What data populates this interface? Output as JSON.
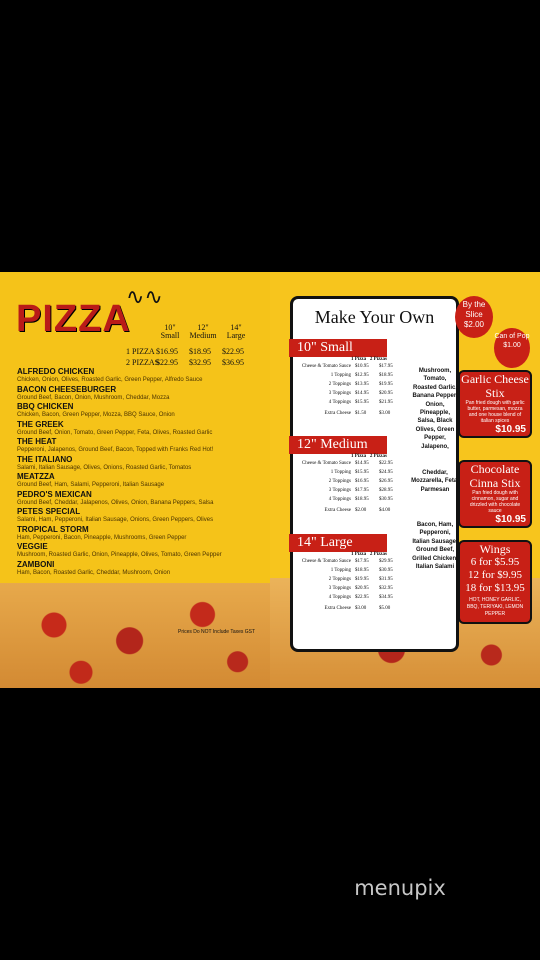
{
  "left": {
    "title": "PIZZA",
    "sizes": [
      {
        "label": "10\"",
        "sub": "Small"
      },
      {
        "label": "12\"",
        "sub": "Medium"
      },
      {
        "label": "14\"",
        "sub": "Large"
      }
    ],
    "one_pizza": {
      "label": "1 PIZZA",
      "prices": [
        "$16.95",
        "$18.95",
        "$22.95"
      ]
    },
    "two_pizzas": {
      "label": "2 PIZZAS",
      "prices": [
        "$22.95",
        "$32.95",
        "$36.95"
      ]
    },
    "items": [
      {
        "name": "ALFREDO CHICKEN",
        "desc": "Chicken, Onion, Olives, Roasted Garlic, Green Pepper, Alfredo Sauce"
      },
      {
        "name": "BACON CHEESEBURGER",
        "desc": "Ground Beef, Bacon, Onion, Mushroom, Cheddar, Mozza"
      },
      {
        "name": "BBQ CHICKEN",
        "desc": "Chicken, Bacon, Green Pepper, Mozza, BBQ Sauce, Onion"
      },
      {
        "name": "THE GREEK",
        "desc": "Ground Beef, Onion, Tomato, Green Pepper, Feta, Olives, Roasted Garlic"
      },
      {
        "name": "THE HEAT",
        "desc": "Pepperoni, Jalapenos, Ground Beef, Bacon, Topped with Franks Red Hot!"
      },
      {
        "name": "THE ITALIANO",
        "desc": "Salami, Italian Sausage, Olives, Onions, Roasted Garlic, Tomatos"
      },
      {
        "name": "MEATZZA",
        "desc": "Ground Beef, Ham, Salami, Pepperoni, Italian Sausage"
      },
      {
        "name": "PEDRO'S MEXICAN",
        "desc": "Ground Beef, Cheddar, Jalapenos, Olives, Onion, Banana Peppers, Salsa"
      },
      {
        "name": "PETES SPECIAL",
        "desc": "Salami, Ham, Pepperoni, Italian Sausage, Onions, Green Peppers, Olives"
      },
      {
        "name": "TROPICAL STORM",
        "desc": "Ham, Pepperoni, Bacon, Pineapple, Mushrooms, Green Pepper"
      },
      {
        "name": "VEGGIE",
        "desc": "Mushroom, Roasted Garlic, Onion, Pineapple, Olives, Tomato, Green Pepper"
      },
      {
        "name": "ZAMBONI",
        "desc": "Ham, Bacon, Roasted Garlic, Cheddar, Mushroom, Onion"
      }
    ],
    "note": "Prices Do NOT Include Taxes GST"
  },
  "right": {
    "title": "Make Your Own",
    "col_1": "1 Pizza",
    "col_2": "2 Pizzas",
    "sections": [
      {
        "size": "10\" Small",
        "rows": [
          {
            "l": "Cheese & Tomato Sauce",
            "a": "$10.95",
            "b": "$17.95"
          },
          {
            "l": "1 Topping",
            "a": "$12.95",
            "b": "$18.95"
          },
          {
            "l": "2 Toppings",
            "a": "$13.95",
            "b": "$19.95"
          },
          {
            "l": "3 Toppings",
            "a": "$14.95",
            "b": "$20.95"
          },
          {
            "l": "4 Toppings",
            "a": "$15.95",
            "b": "$21.95"
          },
          {
            "l": "Extra Cheese",
            "a": "$1.50",
            "b": "$3.00"
          }
        ]
      },
      {
        "size": "12\" Medium",
        "rows": [
          {
            "l": "Cheese & Tomato Sauce",
            "a": "$14.95",
            "b": "$22.95"
          },
          {
            "l": "1 Topping",
            "a": "$15.95",
            "b": "$24.95"
          },
          {
            "l": "2 Toppings",
            "a": "$16.95",
            "b": "$26.95"
          },
          {
            "l": "3 Toppings",
            "a": "$17.95",
            "b": "$28.95"
          },
          {
            "l": "4 Toppings",
            "a": "$18.95",
            "b": "$30.95"
          },
          {
            "l": "Extra Cheese",
            "a": "$2.00",
            "b": "$4.00"
          }
        ]
      },
      {
        "size": "14\" Large",
        "rows": [
          {
            "l": "Cheese & Tomato Sauce",
            "a": "$17.95",
            "b": "$29.95"
          },
          {
            "l": "1 Topping",
            "a": "$18.95",
            "b": "$30.95"
          },
          {
            "l": "2 Toppings",
            "a": "$19.95",
            "b": "$31.95"
          },
          {
            "l": "3 Toppings",
            "a": "$20.95",
            "b": "$32.95"
          },
          {
            "l": "4 Toppings",
            "a": "$22.95",
            "b": "$34.95"
          },
          {
            "l": "Extra Cheese",
            "a": "$3.00",
            "b": "$5.00"
          }
        ]
      }
    ],
    "toppings_1": "Mushroom, Tomato, Roasted Garlic, Banana Pepper, Onion, Pineapple, Salsa, Black Olives, Green Pepper, Jalapeno,",
    "toppings_2": "Cheddar, Mozzarella, Feta, Parmesan",
    "toppings_3": "Bacon, Ham, Pepperoni, Italian Sausage, Ground Beef, Grilled Chicken, Italian Salami",
    "by_slice": "By the Slice",
    "slice_price": "$2.00",
    "can_pop": "Can of Pop",
    "pop_price": "$1.00",
    "garlic": {
      "title": "Garlic Cheese Stix",
      "desc": "Pan fried dough with garlic butter, parmesan, mozza and one house blend of italian spices",
      "price": "$10.95"
    },
    "cinna": {
      "title": "Chocolate Cinna Stix",
      "desc": "Pan fried dough with cinnamon, sugar and drizzled with chocolate sauce",
      "price": "$10.95"
    },
    "wings": {
      "title": "Wings",
      "r1": "6 for $5.95",
      "r2": "12 for $9.95",
      "r3": "18 for $13.95",
      "flavors": "HOT, HONEY GARLIC, BBQ, TERIYAKI, LEMON PEPPER"
    }
  },
  "watermark": "menupix"
}
